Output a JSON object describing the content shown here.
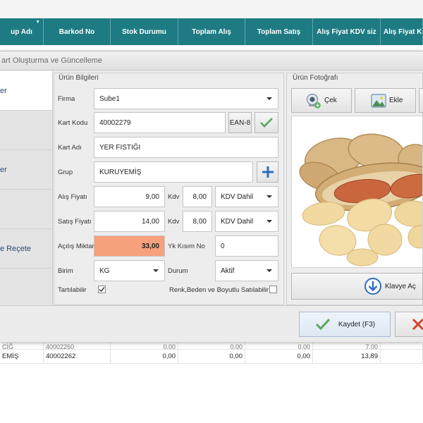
{
  "grid": {
    "columns": [
      "up Adı",
      "Barkod No",
      "Stok Durumu",
      "Toplam Alış",
      "Toplam Satış",
      "Alış Fiyat KDV siz",
      "Alış Fiyat KDV"
    ],
    "partial_row": [
      "ÇİĞ",
      "40002260",
      "0,00",
      "0,00",
      "0,00",
      "7,00",
      ""
    ],
    "row": [
      "EMİŞ",
      "40002262",
      "0,00",
      "0,00",
      "0,00",
      "13,89",
      ""
    ]
  },
  "dialog": {
    "title": "art Oluşturma ve Güncelleme",
    "sidebar": [
      {
        "label": "er"
      },
      {
        "label": ""
      },
      {
        "label": "er"
      },
      {
        "label": ""
      },
      {
        "label": "e Reçete"
      }
    ],
    "urun_bilgileri": {
      "section_title": "Ürün Bilgileri",
      "firma_label": "Firma",
      "firma_value": "Sube1",
      "kart_kodu_label": "Kart Kodu",
      "kart_kodu_value": "40002279",
      "ean_button": "EAN-8",
      "kart_adi_label": "Kart Adı",
      "kart_adi_value": "YER FISTIĞI",
      "grup_label": "Grup",
      "grup_value": "KURUYEMİŞ",
      "alis_fiyati_label": "Alış Fiyatı",
      "alis_fiyati_value": "9,00",
      "kdv_label_1": "Kdv",
      "kdv_value_1": "8,00",
      "kdv_type_1": "KDV Dahil",
      "satis_fiyati_label": "Satış Fiyatı",
      "satis_fiyati_value": "14,00",
      "kdv_label_2": "Kdv",
      "kdv_value_2": "8,00",
      "kdv_type_2": "KDV Dahil",
      "acilis_miktar_label": "Açılış Miktar",
      "acilis_miktar_value": "33,00",
      "yk_kisim_label": "Yk Kısım No",
      "yk_kisim_value": "0",
      "birim_label": "Birim",
      "birim_value": "KG",
      "durum_label": "Durum",
      "durum_value": "Aktif",
      "tartilabilir_label": "Tartılabilir",
      "renk_label": "Renk,Beden ve Boyutlu Satılabilir"
    },
    "urun_fotografi": {
      "section_title": "Ürün Fotoğrafı",
      "cek_button": "Çek",
      "ekle_button": "Ekle",
      "klavye_button": "Klavye Aç"
    },
    "footer": {
      "kaydet_button": "Kaydet (F3)"
    }
  },
  "colors": {
    "grid_header": "#1e7b83",
    "acilis_highlight": "#f7a07c",
    "accent_blue": "#2e6cc0",
    "check_green": "#5aa55a"
  }
}
